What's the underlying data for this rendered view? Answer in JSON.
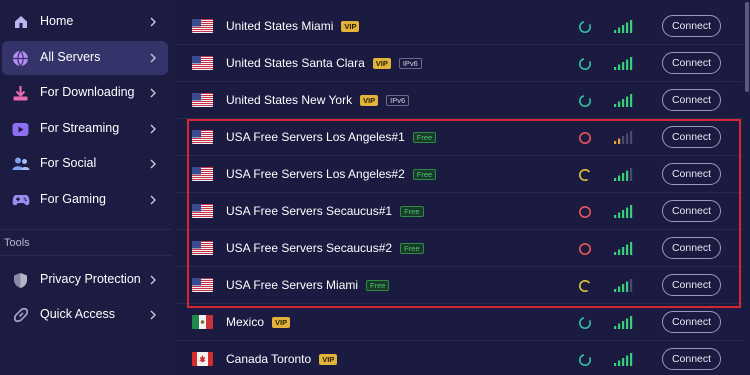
{
  "sidebar": {
    "items": [
      {
        "label": "Home",
        "icon": "home-icon"
      },
      {
        "label": "All Servers",
        "icon": "globe-icon",
        "active": true
      },
      {
        "label": "For Downloading",
        "icon": "download-icon"
      },
      {
        "label": "For Streaming",
        "icon": "play-icon"
      },
      {
        "label": "For Social",
        "icon": "people-icon"
      },
      {
        "label": "For Gaming",
        "icon": "gamepad-icon"
      }
    ],
    "tools_label": "Tools",
    "tools": [
      {
        "label": "Privacy Protection",
        "icon": "shield-icon"
      },
      {
        "label": "Quick Access",
        "icon": "link-icon"
      }
    ]
  },
  "servers": [
    {
      "name": "United States Miami",
      "flag": "us",
      "badges": [
        "VIP"
      ],
      "latency": "good",
      "signal": 5,
      "connect": "Connect"
    },
    {
      "name": "United States Santa Clara",
      "flag": "us",
      "badges": [
        "VIP",
        "IPv6"
      ],
      "latency": "good",
      "signal": 5,
      "connect": "Connect"
    },
    {
      "name": "United States New York",
      "flag": "us",
      "badges": [
        "VIP",
        "IPv6"
      ],
      "latency": "good",
      "signal": 5,
      "connect": "Connect"
    },
    {
      "name": "USA Free Servers Los Angeles#1",
      "flag": "us",
      "badges": [
        "Free"
      ],
      "latency": "bad",
      "signal": 2,
      "connect": "Connect"
    },
    {
      "name": "USA Free Servers Los Angeles#2",
      "flag": "us",
      "badges": [
        "Free"
      ],
      "latency": "medium",
      "signal": 4,
      "connect": "Connect"
    },
    {
      "name": "USA Free Servers Secaucus#1",
      "flag": "us",
      "badges": [
        "Free"
      ],
      "latency": "bad",
      "signal": 5,
      "connect": "Connect"
    },
    {
      "name": "USA Free Servers Secaucus#2",
      "flag": "us",
      "badges": [
        "Free"
      ],
      "latency": "bad",
      "signal": 5,
      "connect": "Connect"
    },
    {
      "name": "USA Free Servers Miami",
      "flag": "us",
      "badges": [
        "Free"
      ],
      "latency": "medium",
      "signal": 4,
      "connect": "Connect"
    },
    {
      "name": "Mexico",
      "flag": "mx",
      "badges": [
        "VIP"
      ],
      "latency": "good",
      "signal": 5,
      "connect": "Connect"
    },
    {
      "name": "Canada Toronto",
      "flag": "ca",
      "badges": [
        "VIP"
      ],
      "latency": "good",
      "signal": 5,
      "connect": "Connect"
    }
  ],
  "colors": {
    "latency_good": "#2fc2a0",
    "latency_medium": "#e6c33c",
    "latency_bad": "#e5575a",
    "signal_green": "#36d07a",
    "signal_orange": "#e2a03a",
    "signal_dim": "#4a4a6e",
    "highlight": "#d9252e"
  }
}
